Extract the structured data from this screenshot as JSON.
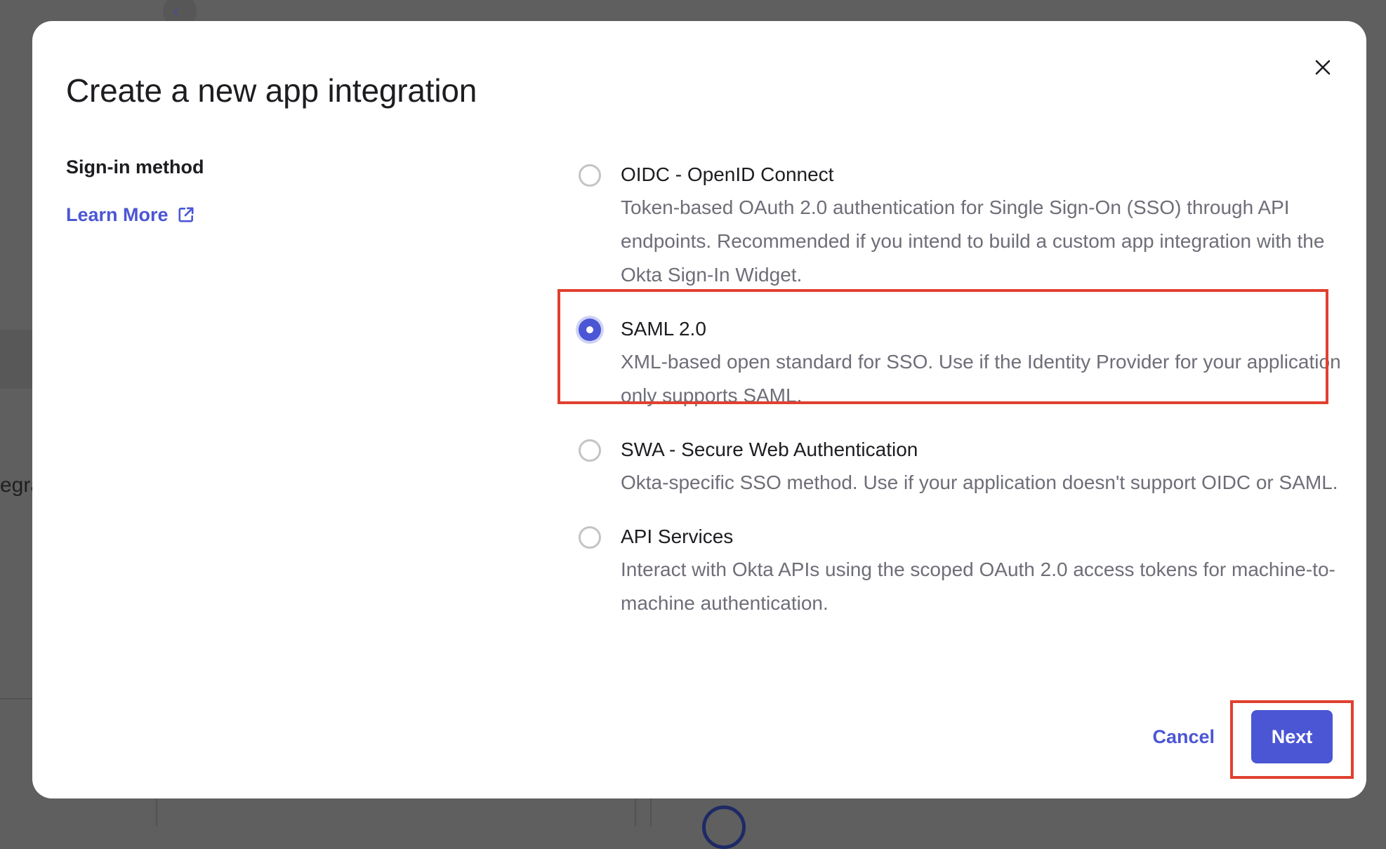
{
  "background": {
    "partial_text": "egra"
  },
  "dialog": {
    "title": "Create a new app integration",
    "close_label": "×",
    "section_label": "Sign-in method",
    "learn_more": "Learn More",
    "options": [
      {
        "title": "OIDC - OpenID Connect",
        "description": "Token-based OAuth 2.0 authentication for Single Sign-On (SSO) through API endpoints. Recommended if you intend to build a custom app integration with the Okta Sign-In Widget.",
        "selected": false
      },
      {
        "title": "SAML 2.0",
        "description": "XML-based open standard for SSO. Use if the Identity Provider for your application only supports SAML.",
        "selected": true
      },
      {
        "title": "SWA - Secure Web Authentication",
        "description": "Okta-specific SSO method. Use if your application doesn't support OIDC or SAML.",
        "selected": false
      },
      {
        "title": "API Services",
        "description": "Interact with Okta APIs using the scoped OAuth 2.0 access tokens for machine-to-machine authentication.",
        "selected": false
      }
    ],
    "cancel_label": "Cancel",
    "next_label": "Next"
  },
  "colors": {
    "accent": "#4b56d4",
    "highlight": "#e0402f",
    "overlay": "#5f5f5f"
  }
}
